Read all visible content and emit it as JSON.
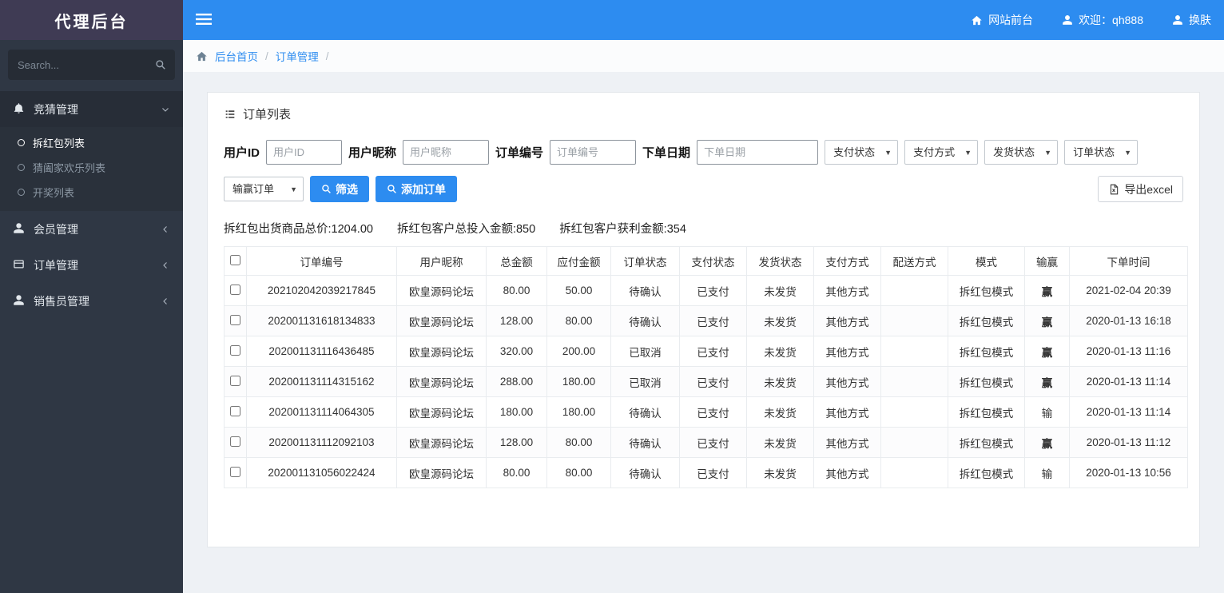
{
  "brand": {
    "title": "代理后台"
  },
  "topbar": {
    "frontend_label": "网站前台",
    "welcome_label": "欢迎：qh888",
    "skin_label": "换肤"
  },
  "sidebar": {
    "search_placeholder": "Search...",
    "menu": [
      {
        "label": "竞猜管理",
        "children": [
          {
            "label": "拆红包列表"
          },
          {
            "label": "猜阖家欢乐列表"
          },
          {
            "label": "开奖列表"
          }
        ]
      },
      {
        "label": "会员管理"
      },
      {
        "label": "订单管理"
      },
      {
        "label": "销售员管理"
      }
    ]
  },
  "breadcrumb": {
    "home": "后台首页",
    "section": "订单管理",
    "separator": "/"
  },
  "panel": {
    "title": "订单列表",
    "filters": {
      "user_id_label": "用户ID",
      "user_id_placeholder": "用户ID",
      "nickname_label": "用户昵称",
      "nickname_placeholder": "用户昵称",
      "order_no_label": "订单编号",
      "order_no_placeholder": "订单编号",
      "order_date_label": "下单日期",
      "order_date_placeholder": "下单日期",
      "pay_status_select": "支付状态",
      "pay_method_select": "支付方式",
      "ship_status_select": "发货状态",
      "order_status_select": "订单状态",
      "win_lose_select": "输赢订单",
      "filter_button": "筛选",
      "add_order_button": "添加订单",
      "export_button": "导出excel"
    },
    "summary": {
      "total_goods": "拆红包出货商品总价:1204.00",
      "total_invest": "拆红包客户总投入金额:850",
      "total_profit": "拆红包客户获利金额:354"
    },
    "table": {
      "columns": [
        {
          "key": "order_no",
          "label": "订单编号",
          "blue": true
        },
        {
          "key": "nickname",
          "label": "用户昵称",
          "blue": true
        },
        {
          "key": "total",
          "label": "总金额",
          "blue": true
        },
        {
          "key": "payable",
          "label": "应付金额",
          "blue": true
        },
        {
          "key": "order_status",
          "label": "订单状态",
          "blue": true
        },
        {
          "key": "pay_status",
          "label": "支付状态",
          "blue": false
        },
        {
          "key": "ship_status",
          "label": "发货状态",
          "blue": false
        },
        {
          "key": "pay_method",
          "label": "支付方式",
          "blue": false
        },
        {
          "key": "delivery",
          "label": "配送方式",
          "blue": false
        },
        {
          "key": "mode",
          "label": "模式",
          "blue": false
        },
        {
          "key": "win",
          "label": "输赢",
          "blue": false
        },
        {
          "key": "time",
          "label": "下单时间",
          "blue": true
        }
      ],
      "rows": [
        {
          "order_no": "202102042039217845",
          "nickname": "欧皇源码论坛",
          "total": "80.00",
          "payable": "50.00",
          "order_status": "待确认",
          "pay_status": "已支付",
          "ship_status": "未发货",
          "pay_method": "其他方式",
          "delivery": "",
          "mode": "拆红包模式",
          "win": "赢",
          "win_type": "win",
          "time": "2021-02-04 20:39"
        },
        {
          "order_no": "202001131618134833",
          "nickname": "欧皇源码论坛",
          "total": "128.00",
          "payable": "80.00",
          "order_status": "待确认",
          "pay_status": "已支付",
          "ship_status": "未发货",
          "pay_method": "其他方式",
          "delivery": "",
          "mode": "拆红包模式",
          "win": "赢",
          "win_type": "win",
          "time": "2020-01-13 16:18"
        },
        {
          "order_no": "202001131116436485",
          "nickname": "欧皇源码论坛",
          "total": "320.00",
          "payable": "200.00",
          "order_status": "已取消",
          "pay_status": "已支付",
          "ship_status": "未发货",
          "pay_method": "其他方式",
          "delivery": "",
          "mode": "拆红包模式",
          "win": "赢",
          "win_type": "win",
          "time": "2020-01-13 11:16"
        },
        {
          "order_no": "202001131114315162",
          "nickname": "欧皇源码论坛",
          "total": "288.00",
          "payable": "180.00",
          "order_status": "已取消",
          "pay_status": "已支付",
          "ship_status": "未发货",
          "pay_method": "其他方式",
          "delivery": "",
          "mode": "拆红包模式",
          "win": "赢",
          "win_type": "win",
          "time": "2020-01-13 11:14"
        },
        {
          "order_no": "202001131114064305",
          "nickname": "欧皇源码论坛",
          "total": "180.00",
          "payable": "180.00",
          "order_status": "待确认",
          "pay_status": "已支付",
          "ship_status": "未发货",
          "pay_method": "其他方式",
          "delivery": "",
          "mode": "拆红包模式",
          "win": "输",
          "win_type": "lose",
          "time": "2020-01-13 11:14"
        },
        {
          "order_no": "202001131112092103",
          "nickname": "欧皇源码论坛",
          "total": "128.00",
          "payable": "80.00",
          "order_status": "待确认",
          "pay_status": "已支付",
          "ship_status": "未发货",
          "pay_method": "其他方式",
          "delivery": "",
          "mode": "拆红包模式",
          "win": "赢",
          "win_type": "win",
          "time": "2020-01-13 11:12"
        },
        {
          "order_no": "202001131056022424",
          "nickname": "欧皇源码论坛",
          "total": "80.00",
          "payable": "80.00",
          "order_status": "待确认",
          "pay_status": "已支付",
          "ship_status": "未发货",
          "pay_method": "其他方式",
          "delivery": "",
          "mode": "拆红包模式",
          "win": "输",
          "win_type": "lose",
          "time": "2020-01-13 10:56"
        }
      ]
    }
  },
  "colors": {
    "topbar_blue": "#2d8cf0",
    "brand_purple": "#3f3b54",
    "sidebar_dark": "#2f3744",
    "win_red": "#e60012",
    "header_link_blue": "#2d8cf0"
  }
}
